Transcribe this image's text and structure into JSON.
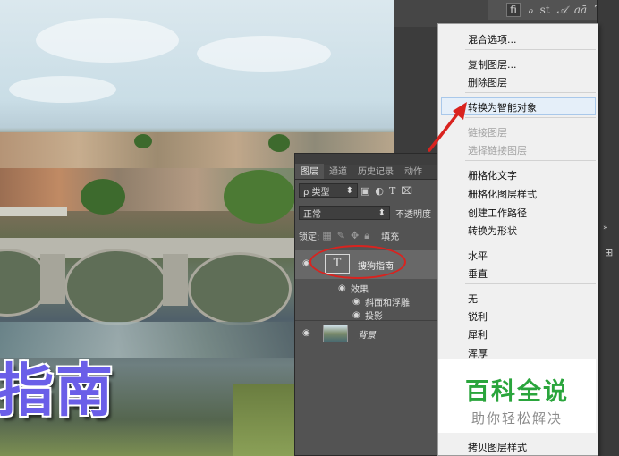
{
  "canvas": {
    "title_text": "指南"
  },
  "char_toolbar": {
    "glyphs": [
      "fi",
      "ℴ",
      "st",
      "𝒜",
      "aā",
      "T"
    ]
  },
  "layers_panel": {
    "tabs": [
      "图层",
      "通道",
      "历史记录",
      "动作"
    ],
    "filter_label": "ρ 类型",
    "blend_mode": "正常",
    "opacity_label": "不透明度",
    "lock_label": "锁定:",
    "fill_label": "填充",
    "layers": [
      {
        "type": "text",
        "thumb": "T",
        "name": "搜狗指南"
      },
      {
        "type": "image",
        "name": "背景"
      }
    ],
    "effects_label": "效果",
    "effects": [
      "斜面和浮雕",
      "投影"
    ]
  },
  "context_menu": {
    "items": [
      {
        "label": "混合选项...",
        "enabled": true
      },
      {
        "label": "复制图层...",
        "enabled": true
      },
      {
        "label": "删除图层",
        "enabled": true
      },
      {
        "label": "转换为智能对象",
        "enabled": true,
        "highlighted": true
      },
      {
        "label": "链接图层",
        "enabled": false
      },
      {
        "label": "选择链接图层",
        "enabled": false
      },
      {
        "label": "栅格化文字",
        "enabled": true
      },
      {
        "label": "栅格化图层样式",
        "enabled": true
      },
      {
        "label": "创建工作路径",
        "enabled": true
      },
      {
        "label": "转换为形状",
        "enabled": true
      },
      {
        "label": "水平",
        "enabled": true
      },
      {
        "label": "垂直",
        "enabled": true
      },
      {
        "label": "无",
        "enabled": true
      },
      {
        "label": "锐利",
        "enabled": true
      },
      {
        "label": "犀利",
        "enabled": true
      },
      {
        "label": "浑厚",
        "enabled": true
      },
      {
        "label": "拷贝图层样式",
        "enabled": true
      }
    ]
  },
  "watermark": {
    "main": "百科全说",
    "sub": "助你轻松解决"
  },
  "colors": {
    "title_text": "#6a5ee8",
    "annotation": "#d9231f",
    "watermark_green": "#2aa53c",
    "menu_highlight": "#e5eff9"
  }
}
